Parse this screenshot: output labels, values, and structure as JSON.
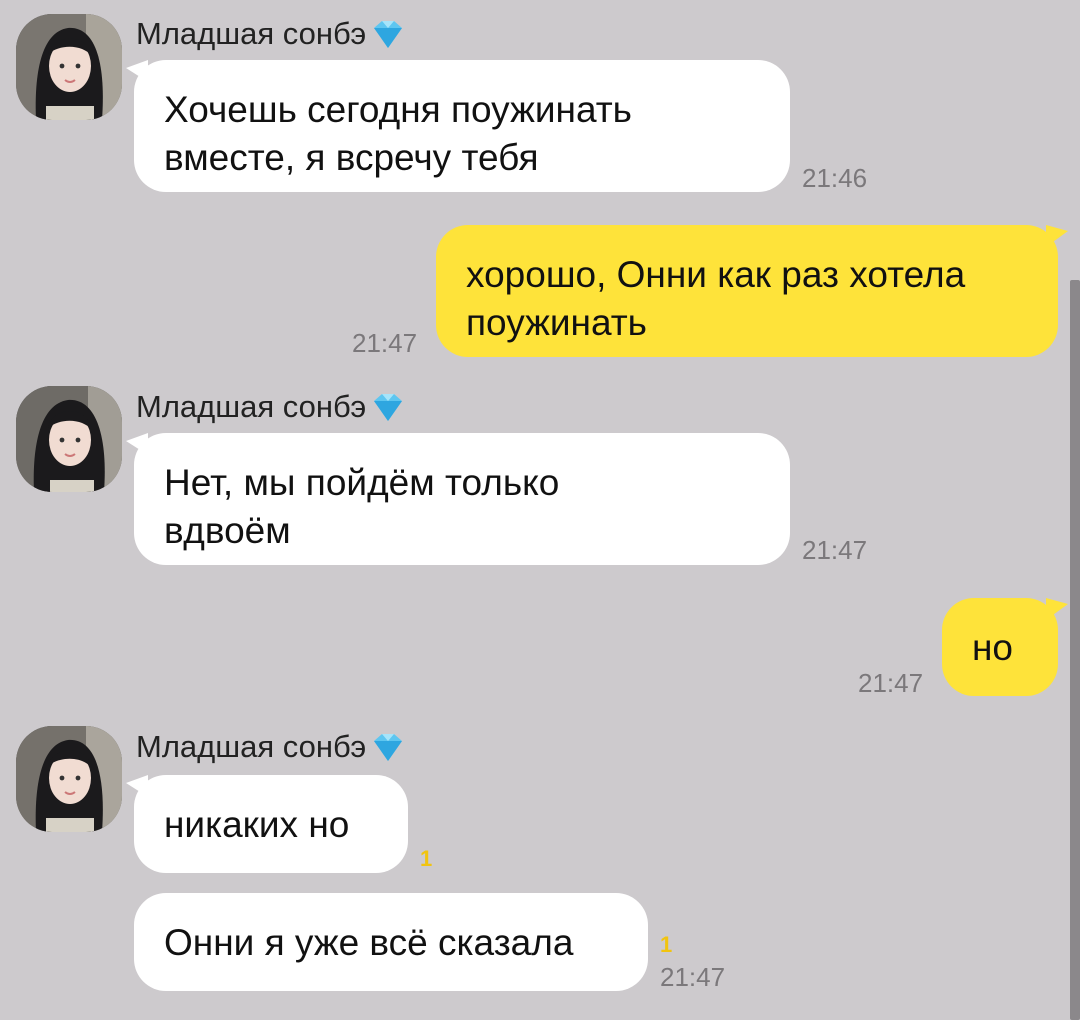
{
  "colors": {
    "background": "#cdcacd",
    "incoming_bubble": "#ffffff",
    "outgoing_bubble": "#fee33a",
    "time_text": "#7b787b",
    "unread": "#f1c40f"
  },
  "messages": [
    {
      "type": "incoming",
      "sender": "Младшая сонбэ",
      "badge_icon": "diamond-icon",
      "lines": [
        "Хочешь сегодня поужинать",
        "вместе, я всречу тебя"
      ],
      "time": "21:46"
    },
    {
      "type": "outgoing",
      "lines": [
        "хорошо, Онни как раз хотела",
        "поужинать"
      ],
      "time": "21:47"
    },
    {
      "type": "incoming",
      "sender": "Младшая сонбэ",
      "badge_icon": "diamond-icon",
      "lines": [
        "Нет, мы пойдём только",
        "вдвоём"
      ],
      "time": "21:47"
    },
    {
      "type": "outgoing",
      "lines": [
        "но"
      ],
      "time": "21:47"
    },
    {
      "type": "incoming",
      "sender": "Младшая сонбэ",
      "badge_icon": "diamond-icon",
      "lines": [
        "никаких но"
      ],
      "unread": "1"
    },
    {
      "type": "incoming-continued",
      "lines": [
        "Онни я уже всё сказала"
      ],
      "unread": "1",
      "time": "21:47"
    }
  ]
}
